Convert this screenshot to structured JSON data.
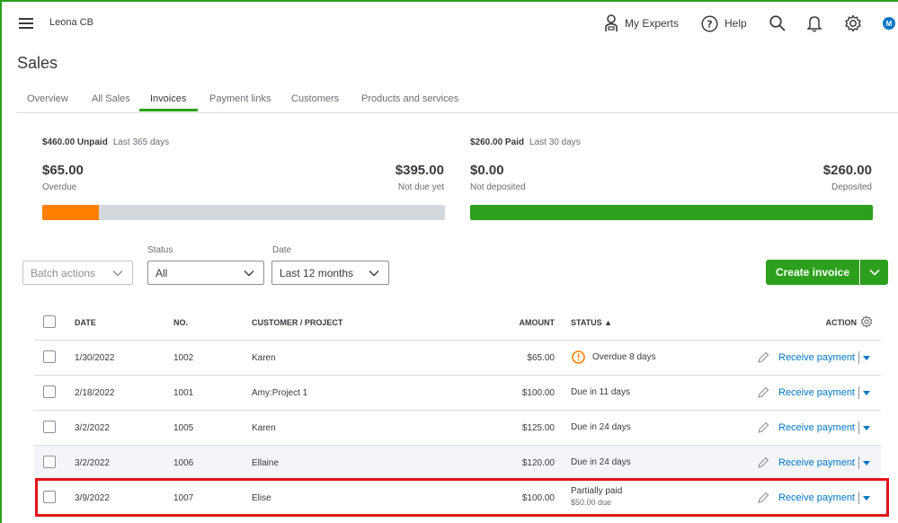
{
  "header": {
    "company": "Leona CB",
    "my_experts": "My Experts",
    "help": "Help",
    "avatar_initial": "M"
  },
  "page": {
    "title": "Sales"
  },
  "tabs": [
    {
      "label": "Overview",
      "active": false
    },
    {
      "label": "All Sales",
      "active": false
    },
    {
      "label": "Invoices",
      "active": true
    },
    {
      "label": "Payment links",
      "active": false
    },
    {
      "label": "Customers",
      "active": false
    },
    {
      "label": "Products and services",
      "active": false
    }
  ],
  "summary": {
    "unpaid": {
      "title": "$460.00 Unpaid",
      "period": "Last 365 days",
      "overdue_amount": "$65.00",
      "overdue_label": "Overdue",
      "notdue_amount": "$395.00",
      "notdue_label": "Not due yet",
      "overdue_fraction": 0.141,
      "overdue_color": "#ff8000",
      "rest_color": "#d4d7dc"
    },
    "paid": {
      "title": "$260.00 Paid",
      "period": "Last 30 days",
      "notdeposited_amount": "$0.00",
      "notdeposited_label": "Not deposited",
      "deposited_amount": "$260.00",
      "deposited_label": "Deposited",
      "deposited_fraction": 1.0,
      "deposited_color": "#2ca01c"
    }
  },
  "filters": {
    "batch_actions": "Batch actions",
    "status_label": "Status",
    "status_value": "All",
    "date_label": "Date",
    "date_value": "Last 12 months"
  },
  "actions": {
    "create_invoice": "Create invoice"
  },
  "table": {
    "headers": {
      "date": "DATE",
      "no": "NO.",
      "customer": "CUSTOMER / PROJECT",
      "amount": "AMOUNT",
      "status": "STATUS ▲",
      "action": "ACTION"
    },
    "rows": [
      {
        "date": "1/30/2022",
        "no": "1002",
        "customer": "Karen",
        "amount": "$65.00",
        "status": "Overdue 8 days",
        "status_sub": "",
        "action": "Receive payment"
      },
      {
        "date": "2/18/2022",
        "no": "1001",
        "customer": "Amy:Project 1",
        "amount": "$100.00",
        "status": "Due in 11 days",
        "status_sub": "",
        "action": "Receive payment"
      },
      {
        "date": "3/2/2022",
        "no": "1005",
        "customer": "Karen",
        "amount": "$125.00",
        "status": "Due in 24 days",
        "status_sub": "",
        "action": "Receive payment"
      },
      {
        "date": "3/2/2022",
        "no": "1006",
        "customer": "Ellaine",
        "amount": "$120.00",
        "status": "Due in 24 days",
        "status_sub": "",
        "action": "Receive payment"
      },
      {
        "date": "3/9/2022",
        "no": "1007",
        "customer": "Elise",
        "amount": "$100.00",
        "status": "Partially paid",
        "status_sub": "$50.00 due",
        "action": "Receive payment"
      }
    ]
  },
  "colors": {
    "brand_green": "#2ca01c",
    "link_blue": "#0077c5",
    "overdue_orange": "#ff8000",
    "highlight_red": "#e2141a"
  }
}
